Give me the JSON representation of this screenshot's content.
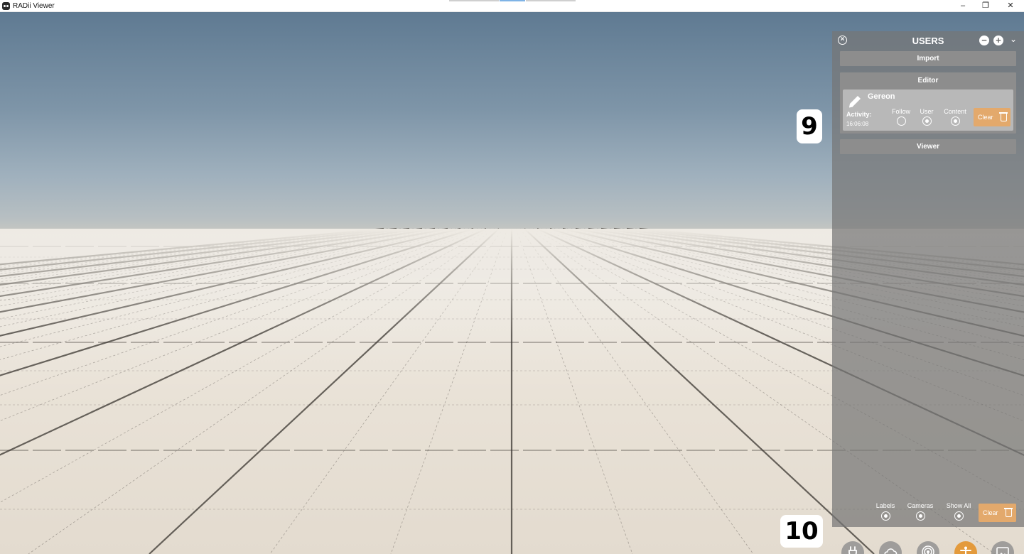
{
  "window": {
    "title": "RADii Viewer",
    "minimize": "–",
    "maximize": "❐",
    "close": "✕"
  },
  "annotations": {
    "badge_panel": "9",
    "badge_toolbar": "10"
  },
  "users_panel": {
    "title": "USERS",
    "close_icon": "close-circle-icon",
    "collapse_icon": "minus-circle-icon",
    "expand_icon": "plus-circle-icon",
    "chevron": "⌄",
    "import_label": "Import",
    "editor_label": "Editor",
    "viewer_label": "Viewer",
    "user": {
      "name": "Gereon",
      "activity_label": "Activity:",
      "activity_time": "16:06:08",
      "options": [
        {
          "label": "Follow",
          "selected": false
        },
        {
          "label": "User",
          "selected": true
        },
        {
          "label": "Content",
          "selected": true
        }
      ],
      "clear_label": "Clear"
    },
    "bottom_options": [
      {
        "label": "Labels",
        "selected": true
      },
      {
        "label": "Cameras",
        "selected": true
      },
      {
        "label": "Show All",
        "selected": true
      }
    ],
    "bottom_clear_label": "Clear"
  },
  "toolbar": {
    "items": [
      {
        "icon": "plug-icon",
        "active": false
      },
      {
        "icon": "cloud-icon",
        "active": false
      },
      {
        "icon": "broadcast-icon",
        "active": false
      },
      {
        "icon": "person-icon",
        "active": true
      },
      {
        "icon": "image-icon",
        "active": false
      }
    ]
  },
  "colors": {
    "accent_orange": "#e3a96c",
    "active_tool": "#e39a3c",
    "panel_bg": "#767676"
  }
}
